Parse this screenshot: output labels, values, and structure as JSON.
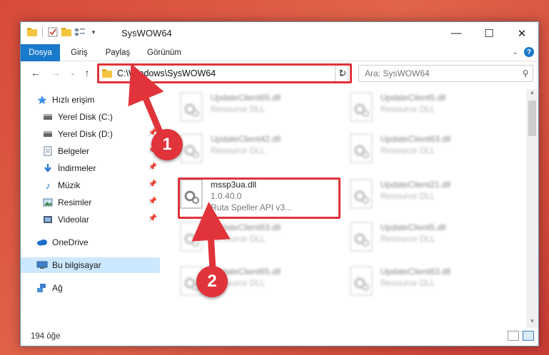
{
  "window": {
    "title": "SysWOW64",
    "controls": {
      "minimize": "—",
      "maximize": "☐",
      "close": "✕"
    }
  },
  "ribbon": {
    "tabs": [
      "Dosya",
      "Giriş",
      "Paylaş",
      "Görünüm"
    ],
    "help": "?"
  },
  "address": {
    "path": "C:\\Windows\\SysWOW64",
    "search_placeholder": "Ara: SysWOW64"
  },
  "sidebar": {
    "items": [
      {
        "label": "Hızlı erişim",
        "icon": "star-icon"
      },
      {
        "label": "Yerel Disk (C:)",
        "icon": "drive-icon"
      },
      {
        "label": "Yerel Disk (D:)",
        "icon": "drive-icon"
      },
      {
        "label": "Belgeler",
        "icon": "documents-icon"
      },
      {
        "label": "İndirmeler",
        "icon": "download-icon"
      },
      {
        "label": "Müzik",
        "icon": "music-icon"
      },
      {
        "label": "Resimler",
        "icon": "pictures-icon"
      },
      {
        "label": "Videolar",
        "icon": "videos-icon"
      },
      {
        "label": "OneDrive",
        "icon": "cloud-icon"
      },
      {
        "label": "Bu bilgisayar",
        "icon": "computer-icon"
      },
      {
        "label": "Ağ",
        "icon": "network-icon"
      }
    ]
  },
  "files": {
    "left": [
      {
        "name": "UpdateClient65.dll",
        "sub": "Resource DLL"
      },
      {
        "name": "UpdateClient42.dll",
        "sub": "Resource DLL"
      },
      {
        "name": "mssp3ua.dll",
        "version": "1.0.40.0",
        "sub": "Ruta Speller API v3..."
      },
      {
        "name": "UpdateClient63.dll",
        "sub": "Resource DLL"
      },
      {
        "name": "UpdateClient65.dll",
        "sub": "Resource DLL"
      }
    ],
    "right": [
      {
        "name": "UpdateClient5.dll",
        "sub": "Resource DLL"
      },
      {
        "name": "UpdateClient63.dll",
        "sub": "Resource DLL"
      },
      {
        "name": "UpdateClient21.dll",
        "sub": "Resource DLL"
      },
      {
        "name": "UpdateClient5.dll",
        "sub": "Resource DLL"
      },
      {
        "name": "UpdateClient63.dll",
        "sub": "Resource DLL"
      }
    ]
  },
  "status": {
    "count": "194 öğe"
  },
  "annotations": {
    "step1": "1",
    "step2": "2"
  },
  "colors": {
    "accent": "#1979ca",
    "highlight": "#e0333a",
    "selected": "#cce8ff"
  }
}
